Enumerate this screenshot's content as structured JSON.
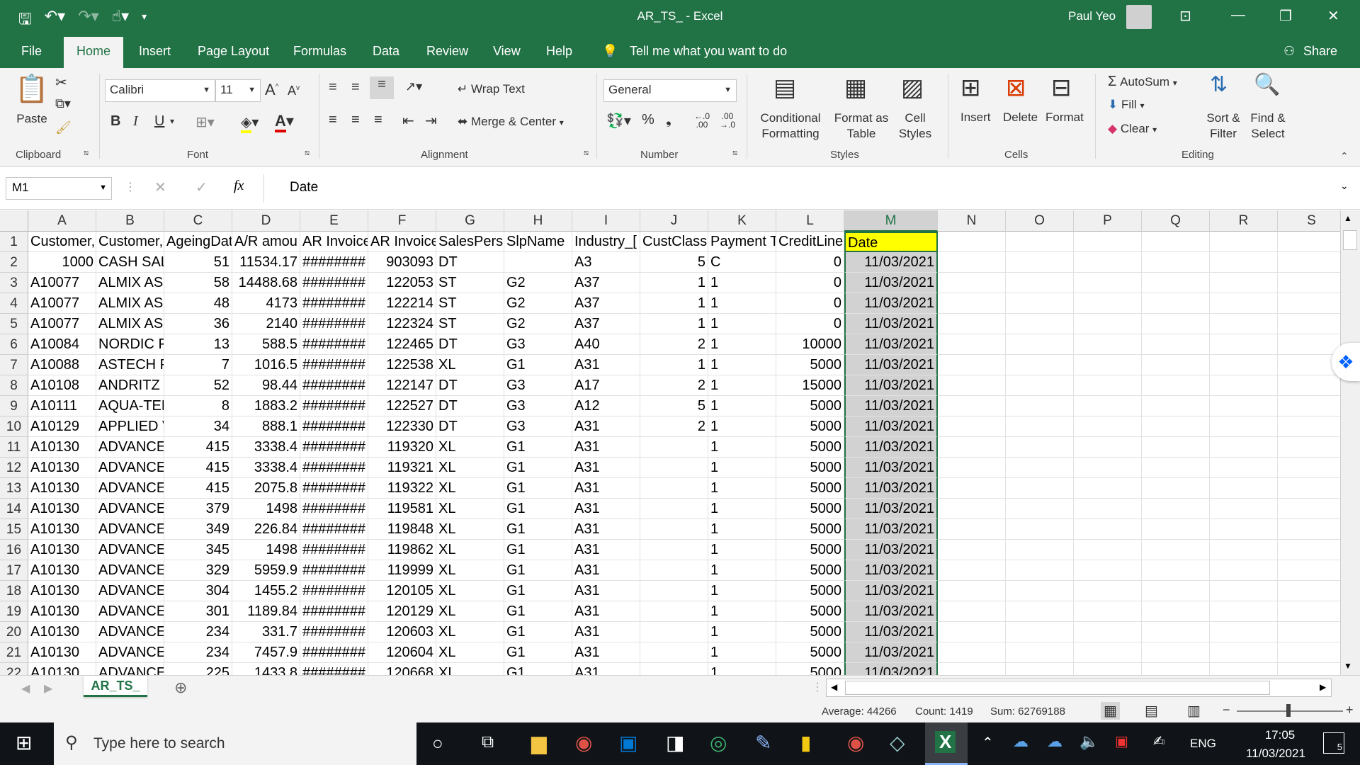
{
  "window": {
    "title": "AR_TS_  -  Excel",
    "user": "Paul Yeo"
  },
  "menu": [
    "File",
    "Home",
    "Insert",
    "Page Layout",
    "Formulas",
    "Data",
    "Review",
    "View",
    "Help"
  ],
  "tellme": "Tell me what you want to do",
  "share": "Share",
  "ribbon": {
    "clipboard": {
      "paste": "Paste",
      "label": "Clipboard"
    },
    "font": {
      "name": "Calibri",
      "size": "11",
      "label": "Font"
    },
    "alignment": {
      "wrap": "Wrap Text",
      "merge": "Merge & Center",
      "label": "Alignment"
    },
    "number": {
      "format": "General",
      "label": "Number"
    },
    "styles": {
      "conditional": "Conditional Formatting",
      "format_table": "Format as Table",
      "cell_styles": "Cell Styles",
      "label": "Styles"
    },
    "cells": {
      "insert": "Insert",
      "delete": "Delete",
      "format": "Format",
      "label": "Cells"
    },
    "editing": {
      "autosum": "AutoSum",
      "fill": "Fill",
      "clear": "Clear",
      "sort": "Sort & Filter",
      "find": "Find & Select",
      "label": "Editing"
    }
  },
  "formula_bar": {
    "namebox": "M1",
    "fx": "fx",
    "value": "Date"
  },
  "columns": [
    "A",
    "B",
    "C",
    "D",
    "E",
    "F",
    "G",
    "H",
    "I",
    "J",
    "K",
    "L",
    "M",
    "N",
    "O",
    "P",
    "Q",
    "R",
    "S"
  ],
  "header_row": [
    "Customer,",
    "Customer,",
    "AgeingDat",
    "A/R amou",
    "AR Invoice",
    "AR Invoice",
    "SalesPersc",
    "SlpName",
    "Industry_[",
    "CustClass",
    "Payment T",
    "CreditLine",
    "Date"
  ],
  "rows": [
    [
      "1000",
      "CASH SALE",
      "51",
      "11534.17",
      "########",
      "903093",
      "DT",
      "",
      "A3",
      "5",
      "C",
      "0",
      "11/03/2021"
    ],
    [
      "A10077",
      "ALMIX ASI",
      "58",
      "14488.68",
      "########",
      "122053",
      "ST",
      "G2",
      "A37",
      "1",
      "1",
      "0",
      "11/03/2021"
    ],
    [
      "A10077",
      "ALMIX ASI",
      "48",
      "4173",
      "########",
      "122214",
      "ST",
      "G2",
      "A37",
      "1",
      "1",
      "0",
      "11/03/2021"
    ],
    [
      "A10077",
      "ALMIX ASI",
      "36",
      "2140",
      "########",
      "122324",
      "ST",
      "G2",
      "A37",
      "1",
      "1",
      "0",
      "11/03/2021"
    ],
    [
      "A10084",
      "NORDIC FI",
      "13",
      "588.5",
      "########",
      "122465",
      "DT",
      "G3",
      "A40",
      "2",
      "1",
      "10000",
      "11/03/2021"
    ],
    [
      "A10088",
      "ASTECH PT",
      "7",
      "1016.5",
      "########",
      "122538",
      "XL",
      "G1",
      "A31",
      "1",
      "1",
      "5000",
      "11/03/2021"
    ],
    [
      "A10108",
      "ANDRITZ S",
      "52",
      "98.44",
      "########",
      "122147",
      "DT",
      "G3",
      "A17",
      "2",
      "1",
      "15000",
      "11/03/2021"
    ],
    [
      "A10111",
      "AQUA-TER",
      "8",
      "1883.2",
      "########",
      "122527",
      "DT",
      "G3",
      "A12",
      "5",
      "1",
      "5000",
      "11/03/2021"
    ],
    [
      "A10129",
      "APPLIED V",
      "34",
      "888.1",
      "########",
      "122330",
      "DT",
      "G3",
      "A31",
      "2",
      "1",
      "5000",
      "11/03/2021"
    ],
    [
      "A10130",
      "ADVANCEI",
      "415",
      "3338.4",
      "########",
      "119320",
      "XL",
      "G1",
      "A31",
      "",
      "1",
      "5000",
      "11/03/2021"
    ],
    [
      "A10130",
      "ADVANCEI",
      "415",
      "3338.4",
      "########",
      "119321",
      "XL",
      "G1",
      "A31",
      "",
      "1",
      "5000",
      "11/03/2021"
    ],
    [
      "A10130",
      "ADVANCEI",
      "415",
      "2075.8",
      "########",
      "119322",
      "XL",
      "G1",
      "A31",
      "",
      "1",
      "5000",
      "11/03/2021"
    ],
    [
      "A10130",
      "ADVANCEI",
      "379",
      "1498",
      "########",
      "119581",
      "XL",
      "G1",
      "A31",
      "",
      "1",
      "5000",
      "11/03/2021"
    ],
    [
      "A10130",
      "ADVANCEI",
      "349",
      "226.84",
      "########",
      "119848",
      "XL",
      "G1",
      "A31",
      "",
      "1",
      "5000",
      "11/03/2021"
    ],
    [
      "A10130",
      "ADVANCEI",
      "345",
      "1498",
      "########",
      "119862",
      "XL",
      "G1",
      "A31",
      "",
      "1",
      "5000",
      "11/03/2021"
    ],
    [
      "A10130",
      "ADVANCEI",
      "329",
      "5959.9",
      "########",
      "119999",
      "XL",
      "G1",
      "A31",
      "",
      "1",
      "5000",
      "11/03/2021"
    ],
    [
      "A10130",
      "ADVANCEI",
      "304",
      "1455.2",
      "########",
      "120105",
      "XL",
      "G1",
      "A31",
      "",
      "1",
      "5000",
      "11/03/2021"
    ],
    [
      "A10130",
      "ADVANCEI",
      "301",
      "1189.84",
      "########",
      "120129",
      "XL",
      "G1",
      "A31",
      "",
      "1",
      "5000",
      "11/03/2021"
    ],
    [
      "A10130",
      "ADVANCEI",
      "234",
      "331.7",
      "########",
      "120603",
      "XL",
      "G1",
      "A31",
      "",
      "1",
      "5000",
      "11/03/2021"
    ],
    [
      "A10130",
      "ADVANCEI",
      "234",
      "7457.9",
      "########",
      "120604",
      "XL",
      "G1",
      "A31",
      "",
      "1",
      "5000",
      "11/03/2021"
    ],
    [
      "A10130",
      "ADVANCEI",
      "225",
      "1433.8",
      "########",
      "120668",
      "XL",
      "G1",
      "A31",
      "",
      "1",
      "5000",
      "11/03/2021"
    ]
  ],
  "sheet_tab": "AR_TS_",
  "status": {
    "average": "Average: 44266",
    "count": "Count: 1419",
    "sum": "Sum: 62769188"
  },
  "taskbar": {
    "search": "Type here to search",
    "lang": "ENG",
    "time": "17:05",
    "date": "11/03/2021",
    "notifications": "5"
  },
  "colors": {
    "excel_green": "#217346",
    "selected_header_fill": "#ffff00",
    "selected_col": "#d2d2d2"
  }
}
